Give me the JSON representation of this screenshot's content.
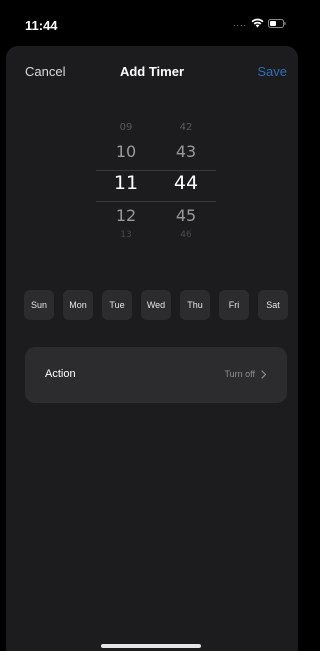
{
  "status_bar": {
    "time": "11:44",
    "signal": "....",
    "icons": [
      "wifi-icon",
      "battery-icon"
    ]
  },
  "header": {
    "cancel": "Cancel",
    "title": "Add Timer",
    "save": "Save"
  },
  "picker": {
    "hours": {
      "far_up": "09",
      "up": "10",
      "selected": "11",
      "down": "12",
      "far_down": "13"
    },
    "minutes": {
      "far_up": "42",
      "up": "43",
      "selected": "44",
      "down": "45",
      "far_down": "46"
    }
  },
  "days": [
    "Sun",
    "Mon",
    "Tue",
    "Wed",
    "Thu",
    "Fri",
    "Sat"
  ],
  "action": {
    "label": "Action",
    "value": "Turn off",
    "chevron": ">"
  },
  "colors": {
    "accent": "#2f6fb5",
    "sheet_bg": "#1c1c1e",
    "card_bg": "#2c2c2e"
  }
}
